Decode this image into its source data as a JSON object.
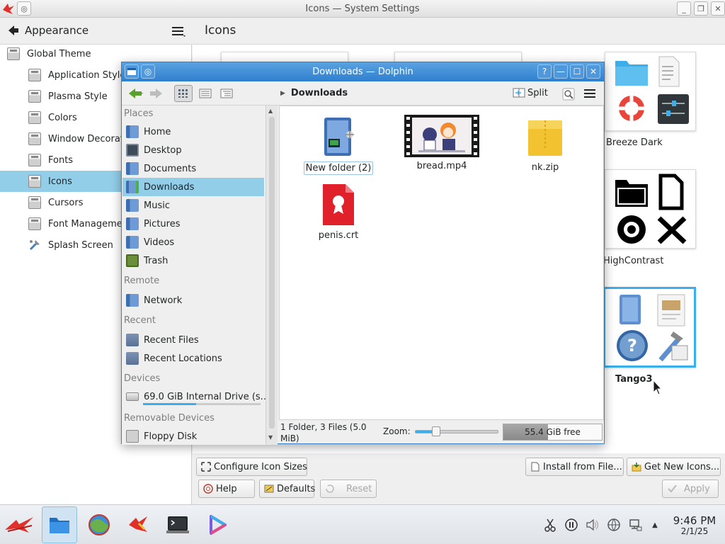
{
  "settings_window": {
    "title": "Icons — System Settings",
    "left_header_title": "Appearance",
    "right_header_title": "Icons",
    "categories": [
      {
        "label": "Global Theme"
      },
      {
        "label": "Application Style"
      },
      {
        "label": "Plasma Style"
      },
      {
        "label": "Colors"
      },
      {
        "label": "Window Decorations"
      },
      {
        "label": "Fonts"
      },
      {
        "label": "Icons"
      },
      {
        "label": "Cursors"
      },
      {
        "label": "Font Management"
      },
      {
        "label": "Splash Screen"
      }
    ],
    "selected_category": "Icons",
    "themes": [
      {
        "name": "Breeze Dark"
      },
      {
        "name": "HighContrast"
      },
      {
        "name": "Tango3"
      }
    ],
    "buttons": {
      "configure_icon_sizes": "Configure Icon Sizes",
      "install_from_file": "Install from File...",
      "get_new_icons": "Get New Icons...",
      "help": "Help",
      "defaults": "Defaults",
      "reset": "Reset",
      "apply": "Apply"
    }
  },
  "dolphin": {
    "title": "Downloads — Dolphin",
    "breadcrumb": "Downloads",
    "split_label": "Split",
    "sections": {
      "places": "Places",
      "remote": "Remote",
      "recent": "Recent",
      "devices": "Devices",
      "removable": "Removable Devices"
    },
    "places": [
      {
        "label": "Home"
      },
      {
        "label": "Desktop"
      },
      {
        "label": "Documents"
      },
      {
        "label": "Downloads"
      },
      {
        "label": "Music"
      },
      {
        "label": "Pictures"
      },
      {
        "label": "Videos"
      },
      {
        "label": "Trash"
      }
    ],
    "remote": [
      {
        "label": "Network"
      }
    ],
    "recent": [
      {
        "label": "Recent Files"
      },
      {
        "label": "Recent Locations"
      }
    ],
    "devices": [
      {
        "label": "69.0 GiB Internal Drive (s..."
      }
    ],
    "removable": [
      {
        "label": "Floppy Disk"
      }
    ],
    "files": [
      {
        "name": "New folder (2)",
        "type": "folder"
      },
      {
        "name": "bread.mp4",
        "type": "video"
      },
      {
        "name": "nk.zip",
        "type": "archive"
      },
      {
        "name": "penis.crt",
        "type": "certificate"
      }
    ],
    "status": {
      "summary": "1 Folder, 3 Files (5.0 MiB)",
      "zoom_label": "Zoom:",
      "zoom_level": 0.25,
      "free_space": "55.4 GiB free",
      "used_fraction": 0.45
    }
  },
  "taskbar": {
    "apps": [
      {
        "icon": "kde-menu-icon"
      },
      {
        "icon": "dolphin-icon"
      },
      {
        "icon": "browser-icon"
      },
      {
        "icon": "app-icon"
      },
      {
        "icon": "terminal-icon"
      },
      {
        "icon": "media-player-icon"
      }
    ],
    "tray": [
      {
        "icon": "scissors-icon"
      },
      {
        "icon": "pause-icon"
      },
      {
        "icon": "volume-icon"
      },
      {
        "icon": "network-icon"
      },
      {
        "icon": "display-icon"
      },
      {
        "icon": "expand-tray-icon"
      }
    ],
    "time": "9:46 PM",
    "date": "2/1/25"
  },
  "colors": {
    "selection": "#93cee9",
    "accent": "#3daee9",
    "dolphin_title": "#2f7fcf"
  }
}
